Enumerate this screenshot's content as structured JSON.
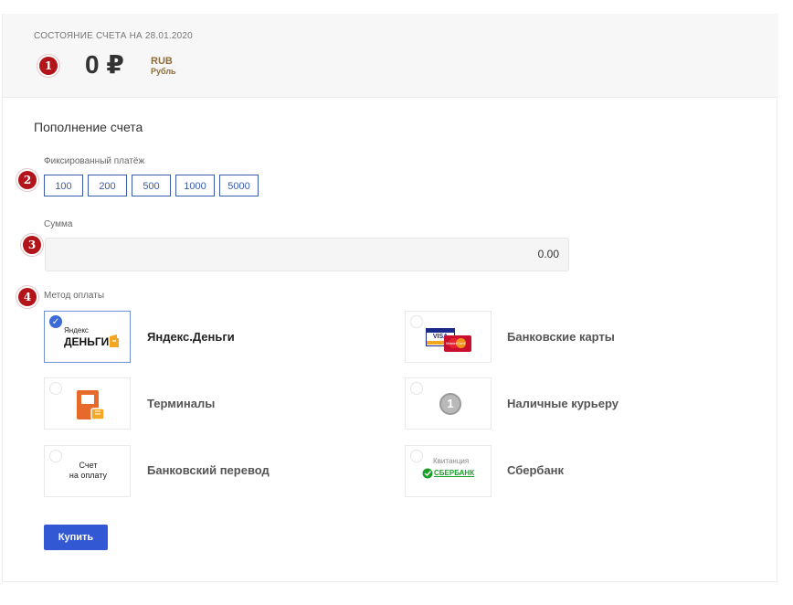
{
  "balance": {
    "caption": "СОСТОЯНИЕ СЧЕТА НА 28.01.2020",
    "amount": "0 ₽",
    "currency_code": "RUB",
    "currency_name": "Рубль"
  },
  "markers": [
    "1",
    "2",
    "3",
    "4"
  ],
  "topup": {
    "title": "Пополнение счета",
    "fixed_label": "Фиксированный платёж",
    "presets": [
      "100",
      "200",
      "500",
      "1000",
      "5000"
    ],
    "sum_label": "Сумма",
    "sum_value": "0.00",
    "method_label": "Метод оплаты",
    "methods": [
      {
        "label": "Яндекс.Деньги",
        "selected": true
      },
      {
        "label": "Банковские карты",
        "selected": false
      },
      {
        "label": "Терминалы",
        "selected": false
      },
      {
        "label": "Наличные курьеру",
        "selected": false
      },
      {
        "label": "Банковский перевод",
        "selected": false
      },
      {
        "label": "Сбербанк",
        "selected": false
      }
    ],
    "logo_text": {
      "yandex_top": "Яндекс",
      "yandex_bottom": "ДЕНЬГИ",
      "visa": "VISA",
      "mastercard": "MasterCard",
      "coin": "1",
      "invoice_line1": "Счет",
      "invoice_line2": "на оплату",
      "sber_top": "Квитанция",
      "sber_name": "СБЕРБАНК"
    },
    "buy_label": "Купить"
  },
  "colors": {
    "accent": "#3358d4",
    "marker": "#b3141a",
    "currency": "#8a6d3b",
    "yandex_orange": "#f4a622",
    "sber_green": "#1a9f29"
  }
}
